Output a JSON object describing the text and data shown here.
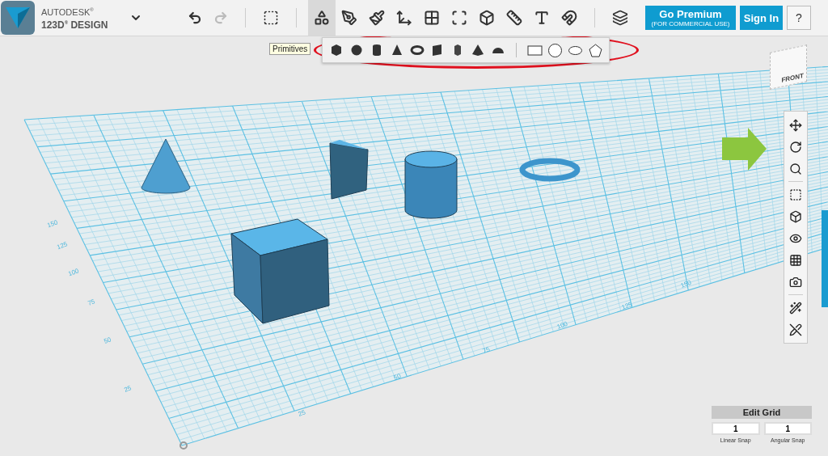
{
  "app": {
    "brand": "AUTODESK$^{®}$",
    "product": "123D$^{®}$ DESIGN"
  },
  "toolbar": {
    "tools": [
      {
        "selected": true
      },
      {
        "selected": false
      },
      {
        "selected": false
      },
      {
        "selected": false
      },
      {
        "selected": false
      },
      {
        "selected": false
      },
      {
        "selected": false
      },
      {
        "selected": false
      },
      {
        "selected": false
      },
      {
        "selected": false
      }
    ],
    "premium": {
      "label": "Go Premium",
      "note": "(FOR COMMERCIAL USE)"
    },
    "sign_in": "Sign In",
    "help": "?"
  },
  "tooltip": "Primitives",
  "primitives": {
    "solids": [
      {
        "kind": "box"
      },
      {
        "kind": "sphere"
      },
      {
        "kind": "cylinder"
      },
      {
        "kind": "cone"
      },
      {
        "kind": "torus"
      },
      {
        "kind": "wedge"
      },
      {
        "kind": "prism"
      },
      {
        "kind": "pyramid"
      },
      {
        "kind": "hemisphere"
      }
    ],
    "sketches": [
      {
        "kind": "rectangle"
      },
      {
        "kind": "circle"
      },
      {
        "kind": "ellipse"
      },
      {
        "kind": "polygon"
      }
    ]
  },
  "view_cube": {
    "face": "FRONT"
  },
  "grid": {
    "left_labels": [
      "25",
      "50",
      "75",
      "100",
      "125",
      "150"
    ],
    "bottom_labels": [
      "25",
      "50",
      "75",
      "100",
      "125",
      "150"
    ]
  },
  "edit_grid": {
    "title": "Edit Grid",
    "linear_value": "1",
    "angular_value": "1",
    "linear_label": "Linear Snap",
    "angular_label": "Angular Snap"
  }
}
